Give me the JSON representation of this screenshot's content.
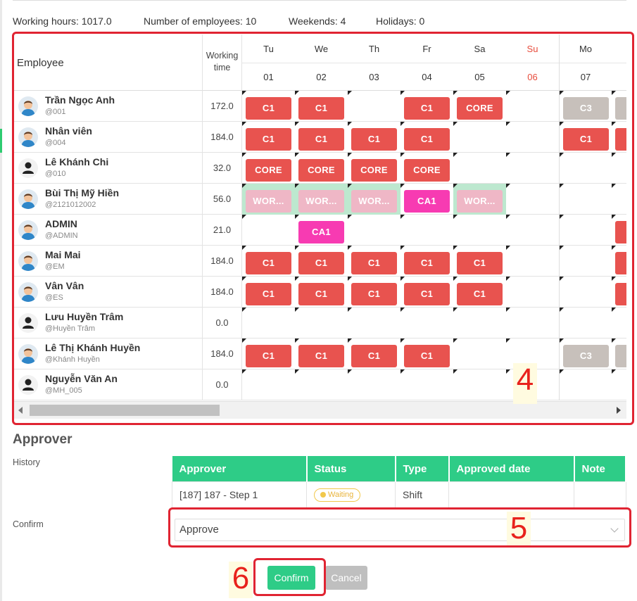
{
  "summary": {
    "working_hours": "Working hours: 1017.0",
    "employees": "Number of employees: 10",
    "weekends": "Weekends: 4",
    "holidays": "Holidays: 0"
  },
  "grid": {
    "employee_header": "Employee",
    "working_time_header": "Working time",
    "days": [
      {
        "dow": "Tu",
        "num": "01",
        "sunday": false
      },
      {
        "dow": "We",
        "num": "02",
        "sunday": false
      },
      {
        "dow": "Th",
        "num": "03",
        "sunday": false
      },
      {
        "dow": "Fr",
        "num": "04",
        "sunday": false
      },
      {
        "dow": "Sa",
        "num": "05",
        "sunday": false
      },
      {
        "dow": "Su",
        "num": "06",
        "sunday": true
      },
      {
        "dow": "Mo",
        "num": "07",
        "sunday": false
      },
      {
        "dow": "",
        "num": "",
        "sunday": false
      }
    ],
    "rows": [
      {
        "name": "Trần Ngọc Anh",
        "code": "@001",
        "time": "172.0",
        "avatar": "person-avatar",
        "shifts": [
          [
            "C1",
            "red"
          ],
          [
            "C1",
            "red"
          ],
          null,
          [
            "C1",
            "red"
          ],
          [
            "CORE",
            "red"
          ],
          null,
          [
            "C3",
            "gray"
          ],
          [
            "",
            "gray"
          ]
        ]
      },
      {
        "name": "Nhân viên",
        "code": "@004",
        "time": "184.0",
        "avatar": "person-avatar",
        "shifts": [
          [
            "C1",
            "red"
          ],
          [
            "C1",
            "red"
          ],
          [
            "C1",
            "red"
          ],
          [
            "C1",
            "red"
          ],
          null,
          null,
          [
            "C1",
            "red"
          ],
          [
            "",
            "red"
          ]
        ]
      },
      {
        "name": "Lê Khánh Chi",
        "code": "@010",
        "time": "32.0",
        "avatar": "user-icon",
        "shifts": [
          [
            "CORE",
            "red"
          ],
          [
            "CORE",
            "red"
          ],
          [
            "CORE",
            "red"
          ],
          [
            "CORE",
            "red"
          ],
          null,
          null,
          null,
          null
        ]
      },
      {
        "name": "Bùi Thị Mỹ Hiền",
        "code": "@2121012002",
        "time": "56.0",
        "avatar": "person-avatar",
        "shifts": [
          [
            "WOR...",
            "light"
          ],
          [
            "WOR...",
            "light"
          ],
          [
            "WOR...",
            "light"
          ],
          [
            "CA1",
            "pink"
          ],
          [
            "WOR...",
            "light"
          ],
          null,
          null,
          null
        ]
      },
      {
        "name": "ADMIN",
        "code": "@ADMIN",
        "time": "21.0",
        "avatar": "person-avatar",
        "shifts": [
          null,
          [
            "CA1",
            "pink"
          ],
          null,
          null,
          null,
          null,
          null,
          [
            "",
            "red"
          ]
        ]
      },
      {
        "name": "Mai Mai",
        "code": "@EM",
        "time": "184.0",
        "avatar": "person-avatar",
        "shifts": [
          [
            "C1",
            "red"
          ],
          [
            "C1",
            "red"
          ],
          [
            "C1",
            "red"
          ],
          [
            "C1",
            "red"
          ],
          [
            "C1",
            "red"
          ],
          null,
          null,
          [
            "",
            "red"
          ]
        ]
      },
      {
        "name": "Vân Vân",
        "code": "@ES",
        "time": "184.0",
        "avatar": "person-avatar",
        "shifts": [
          [
            "C1",
            "red"
          ],
          [
            "C1",
            "red"
          ],
          [
            "C1",
            "red"
          ],
          [
            "C1",
            "red"
          ],
          [
            "C1",
            "red"
          ],
          null,
          null,
          [
            "",
            "red"
          ]
        ]
      },
      {
        "name": "Lưu Huyền Trâm",
        "code": "@Huyền Trâm",
        "time": "0.0",
        "avatar": "user-icon",
        "shifts": [
          null,
          null,
          null,
          null,
          null,
          null,
          null,
          null
        ]
      },
      {
        "name": "Lê Thị Khánh Huyền",
        "code": "@Khánh Huyền",
        "time": "184.0",
        "avatar": "person-avatar",
        "shifts": [
          [
            "C1",
            "red"
          ],
          [
            "C1",
            "red"
          ],
          [
            "C1",
            "red"
          ],
          [
            "C1",
            "red"
          ],
          null,
          null,
          [
            "C3",
            "gray"
          ],
          [
            "",
            "gray"
          ]
        ]
      },
      {
        "name": "Nguyễn Văn An",
        "code": "@MH_005",
        "time": "0.0",
        "avatar": "user-icon",
        "shifts": [
          null,
          null,
          null,
          null,
          null,
          null,
          null,
          null
        ]
      }
    ]
  },
  "annotations": {
    "step4": "4",
    "step5": "5",
    "step6": "6"
  },
  "approver": {
    "title": "Approver",
    "history_label": "History",
    "confirm_label": "Confirm",
    "columns": [
      "Approver",
      "Status",
      "Type",
      "Approved date",
      "Note"
    ],
    "rows": [
      {
        "approver": "[187] 187 - Step 1",
        "status": "Waiting",
        "type": "Shift",
        "approved_date": "",
        "note": ""
      }
    ],
    "decision": "Approve",
    "confirm_button": "Confirm",
    "cancel_button": "Cancel"
  }
}
